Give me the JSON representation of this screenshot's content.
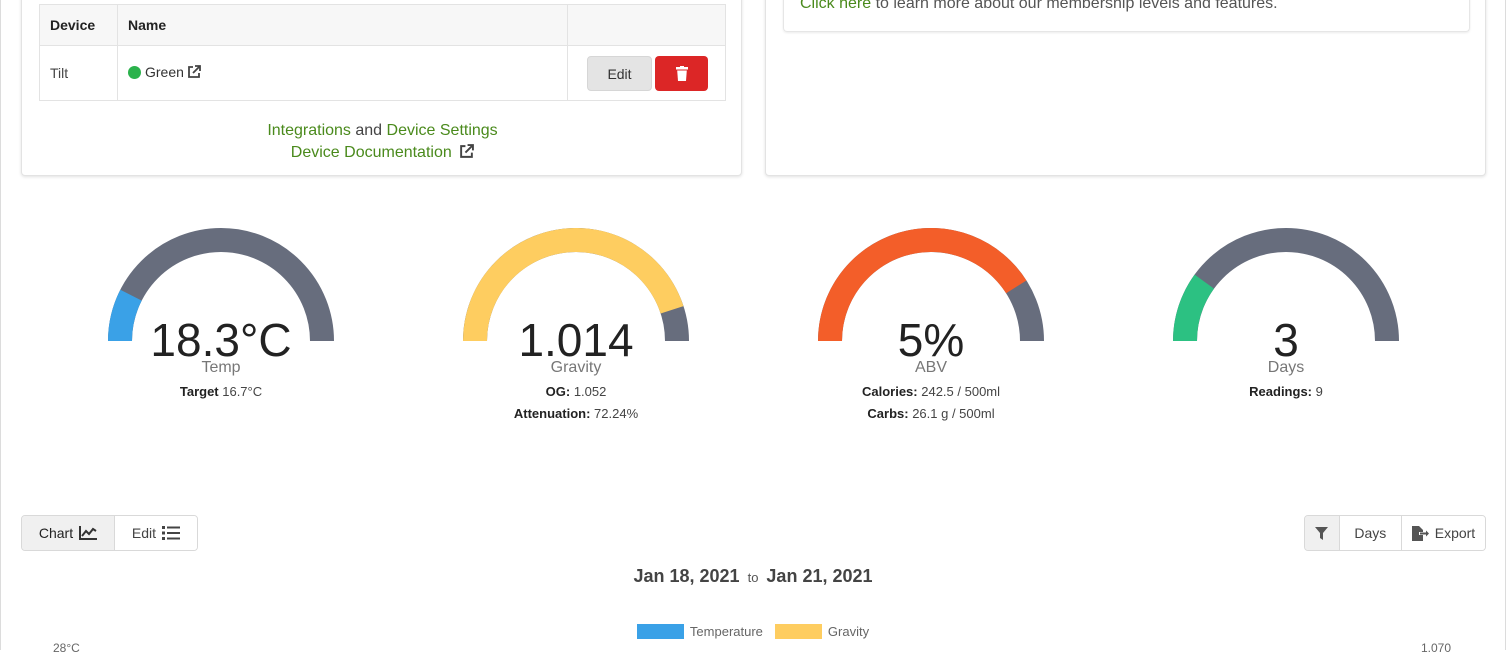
{
  "colors": {
    "link": "#4a8a1c",
    "gauge_track": "#676d7d",
    "temp": "#3aa1e7",
    "gravity": "#fecd60",
    "abv": "#f35e29",
    "days": "#2cc182",
    "delete": "#dc2626",
    "status_green": "#2bb24c"
  },
  "membership": {
    "link_text": "Click here",
    "text": " to learn more about our membership levels and features."
  },
  "devices_table": {
    "headers": [
      "Device",
      "Name",
      ""
    ],
    "rows": [
      {
        "device": "Tilt",
        "name": "Green",
        "status": "green",
        "edit_label": "Edit",
        "delete_icon": "trash-icon"
      }
    ]
  },
  "device_links": {
    "integrations": "Integrations",
    "and": " and ",
    "device_settings": "Device Settings",
    "documentation": "Device Documentation"
  },
  "gauges": [
    {
      "id": "temp",
      "value": "18.3°C",
      "label": "Temp",
      "fill_fraction": 0.15,
      "sub": [
        {
          "key": "Target",
          "value": " 16.7°C"
        }
      ]
    },
    {
      "id": "gravity",
      "value": "1.014",
      "label": "Gravity",
      "fill_fraction": 0.9,
      "sub": [
        {
          "key": "OG:",
          "value": " 1.052"
        },
        {
          "key": "Attenuation:",
          "value": " 72.24%"
        }
      ]
    },
    {
      "id": "abv",
      "value": "5%",
      "label": "ABV",
      "fill_fraction": 0.82,
      "sub": [
        {
          "key": "Calories:",
          "value": " 242.5 / 500ml"
        },
        {
          "key": "Carbs:",
          "value": " 26.1 g / 500ml"
        }
      ]
    },
    {
      "id": "days",
      "value": "3",
      "label": "Days",
      "fill_fraction": 0.2,
      "sub": [
        {
          "key": "Readings:",
          "value": " 9"
        }
      ]
    }
  ],
  "view_toggle": {
    "chart_label": "Chart",
    "edit_label": "Edit"
  },
  "chart_toolbar": {
    "days_label": "Days",
    "export_label": "Export"
  },
  "date_range": {
    "from": "Jan 18, 2021",
    "to_word": "to",
    "to": "Jan 21, 2021"
  },
  "chart_data": {
    "type": "line",
    "series": [
      {
        "name": "Temperature",
        "color": "#3aa1e7",
        "values": []
      },
      {
        "name": "Gravity",
        "color": "#fecd60",
        "values": []
      }
    ],
    "y_left_top_tick": "28°C",
    "y_right_top_tick": "1.070",
    "legend_position": "top-center"
  }
}
